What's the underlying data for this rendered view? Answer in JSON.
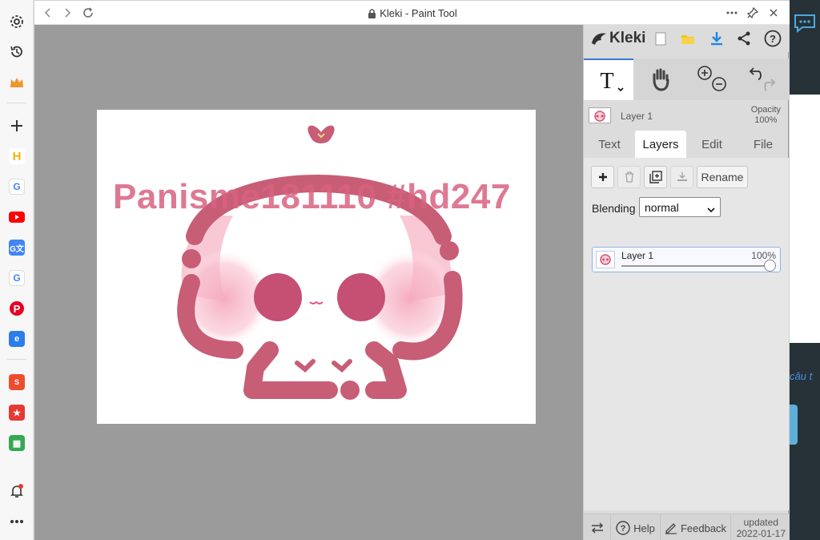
{
  "window": {
    "title": "Kleki - Paint Tool"
  },
  "canvas": {
    "watermark_text": "Panisme181110 #hd247"
  },
  "kleki": {
    "brand": "Kleki",
    "layer_header": {
      "name": "Layer 1",
      "opacity_label": "Opacity",
      "opacity_value": "100%"
    },
    "tabs": [
      {
        "label": "Text"
      },
      {
        "label": "Layers"
      },
      {
        "label": "Edit"
      },
      {
        "label": "File"
      }
    ],
    "active_tab": "Layers",
    "rename_label": "Rename",
    "blending_label": "Blending",
    "blending_value": "normal",
    "layer_item": {
      "name": "Layer 1",
      "opacity": "100%",
      "opacity_fraction": 1.0
    },
    "footer": {
      "help": "Help",
      "feedback": "Feedback",
      "updated_label": "updated",
      "updated_date": "2022-01-17"
    }
  },
  "background_page": {
    "link_text": "câu t"
  },
  "colors": {
    "accent": "#3a7bd5",
    "ink": "#d06f86",
    "canvas_bg": "#9b9b9b",
    "panel_bg": "#dcdcdc"
  }
}
